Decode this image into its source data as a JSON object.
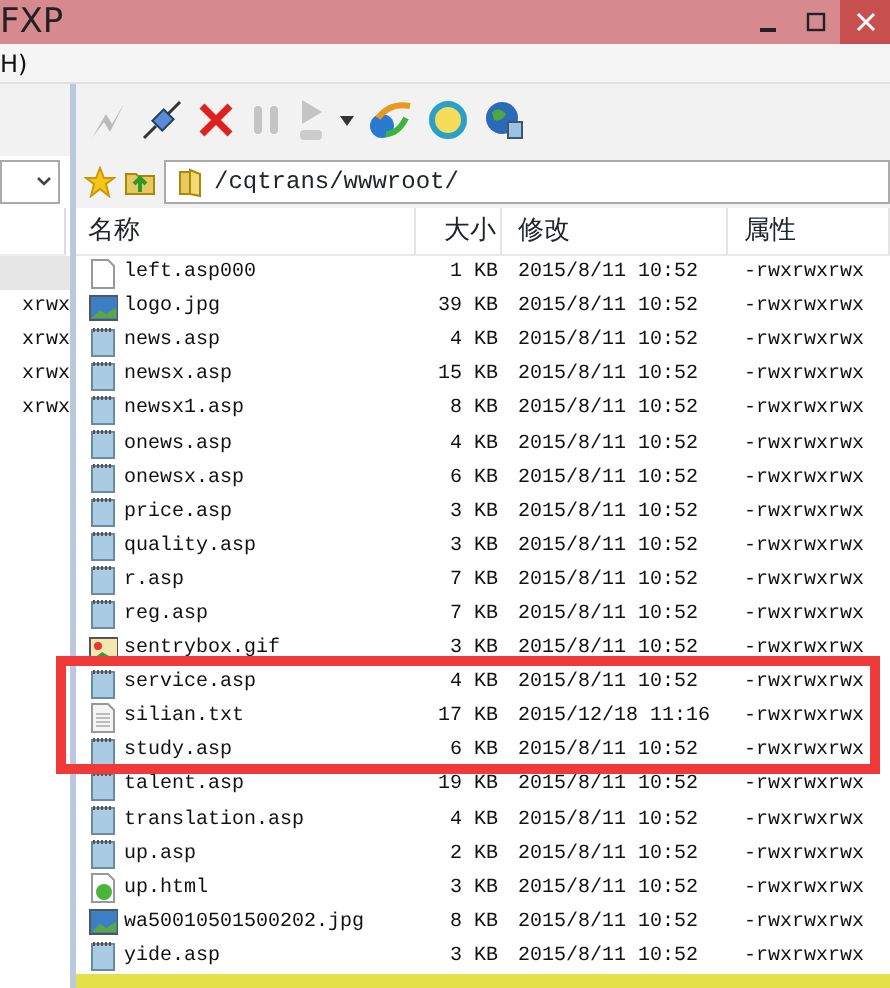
{
  "window": {
    "title": "FXP"
  },
  "menu_bar": {
    "items": [
      "H)"
    ]
  },
  "left_panel": {
    "rows": [
      "xrwx",
      "xrwx",
      "xrwx",
      "xrwx"
    ]
  },
  "address_bar": {
    "path": "/cqtrans/wwwroot/"
  },
  "table": {
    "columns": [
      "名称",
      "大小",
      "修改",
      "属性"
    ],
    "rows": [
      {
        "kind": "blank",
        "name": "left.asp000",
        "size": "1 KB",
        "modified": "2015/8/11 10:52",
        "attributes": "-rwxrwxrwx",
        "highlighted": false
      },
      {
        "kind": "image",
        "name": "logo.jpg",
        "size": "39 KB",
        "modified": "2015/8/11 10:52",
        "attributes": "-rwxrwxrwx",
        "highlighted": false
      },
      {
        "kind": "notepad",
        "name": "news.asp",
        "size": "4 KB",
        "modified": "2015/8/11 10:52",
        "attributes": "-rwxrwxrwx",
        "highlighted": false
      },
      {
        "kind": "notepad",
        "name": "newsx.asp",
        "size": "15 KB",
        "modified": "2015/8/11 10:52",
        "attributes": "-rwxrwxrwx",
        "highlighted": false
      },
      {
        "kind": "notepad",
        "name": "newsx1.asp",
        "size": "8 KB",
        "modified": "2015/8/11 10:52",
        "attributes": "-rwxrwxrwx",
        "highlighted": false
      },
      {
        "kind": "notepad",
        "name": "onews.asp",
        "size": "4 KB",
        "modified": "2015/8/11 10:52",
        "attributes": "-rwxrwxrwx",
        "highlighted": false
      },
      {
        "kind": "notepad",
        "name": "onewsx.asp",
        "size": "6 KB",
        "modified": "2015/8/11 10:52",
        "attributes": "-rwxrwxrwx",
        "highlighted": false
      },
      {
        "kind": "notepad",
        "name": "price.asp",
        "size": "3 KB",
        "modified": "2015/8/11 10:52",
        "attributes": "-rwxrwxrwx",
        "highlighted": false
      },
      {
        "kind": "notepad",
        "name": "quality.asp",
        "size": "3 KB",
        "modified": "2015/8/11 10:52",
        "attributes": "-rwxrwxrwx",
        "highlighted": false
      },
      {
        "kind": "notepad",
        "name": "r.asp",
        "size": "7 KB",
        "modified": "2015/8/11 10:52",
        "attributes": "-rwxrwxrwx",
        "highlighted": false
      },
      {
        "kind": "notepad",
        "name": "reg.asp",
        "size": "7 KB",
        "modified": "2015/8/11 10:52",
        "attributes": "-rwxrwxrwx",
        "highlighted": false
      },
      {
        "kind": "gif",
        "name": "sentrybox.gif",
        "size": "3 KB",
        "modified": "2015/8/11 10:52",
        "attributes": "-rwxrwxrwx",
        "highlighted": false
      },
      {
        "kind": "notepad",
        "name": "service.asp",
        "size": "4 KB",
        "modified": "2015/8/11 10:52",
        "attributes": "-rwxrwxrwx",
        "highlighted": true
      },
      {
        "kind": "text",
        "name": "silian.txt",
        "size": "17 KB",
        "modified": "2015/12/18 11:16",
        "attributes": "-rwxrwxrwx",
        "highlighted": true
      },
      {
        "kind": "notepad",
        "name": "study.asp",
        "size": "6 KB",
        "modified": "2015/8/11 10:52",
        "attributes": "-rwxrwxrwx",
        "highlighted": true
      },
      {
        "kind": "notepad",
        "name": "talent.asp",
        "size": "19 KB",
        "modified": "2015/8/11 10:52",
        "attributes": "-rwxrwxrwx",
        "highlighted": false
      },
      {
        "kind": "notepad",
        "name": "translation.asp",
        "size": "4 KB",
        "modified": "2015/8/11 10:52",
        "attributes": "-rwxrwxrwx",
        "highlighted": false
      },
      {
        "kind": "notepad",
        "name": "up.asp",
        "size": "2 KB",
        "modified": "2015/8/11 10:52",
        "attributes": "-rwxrwxrwx",
        "highlighted": false
      },
      {
        "kind": "html",
        "name": "up.html",
        "size": "3 KB",
        "modified": "2015/8/11 10:52",
        "attributes": "-rwxrwxrwx",
        "highlighted": false
      },
      {
        "kind": "image",
        "name": "wa50010501500202.jpg",
        "size": "8 KB",
        "modified": "2015/8/11 10:52",
        "attributes": "-rwxrwxrwx",
        "highlighted": false
      },
      {
        "kind": "notepad",
        "name": "yide.asp",
        "size": "3 KB",
        "modified": "2015/8/11 10:52",
        "attributes": "-rwxrwxrwx",
        "highlighted": false
      }
    ]
  }
}
